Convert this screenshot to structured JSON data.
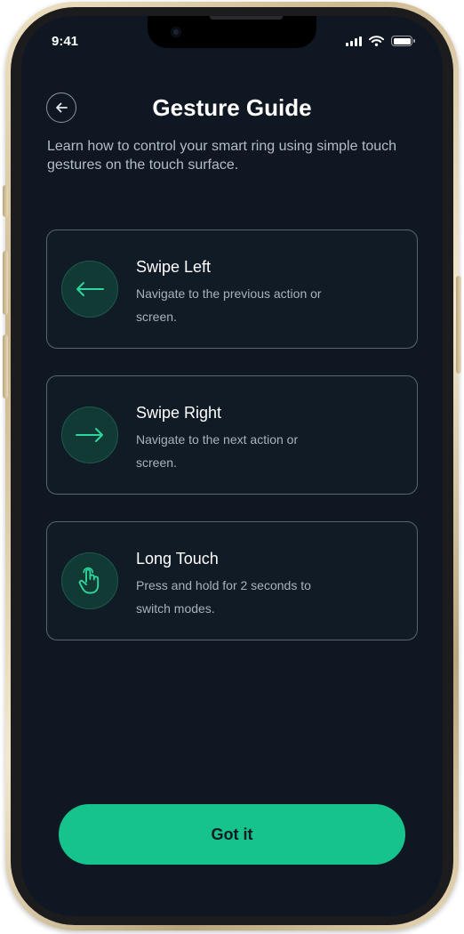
{
  "status_bar": {
    "time": "9:41"
  },
  "header": {
    "title": "Gesture Guide",
    "back_icon": "arrow-left-icon"
  },
  "intro_text": "Learn how to control your smart ring using simple touch gestures on the touch surface.",
  "gestures": [
    {
      "title": "Swipe Left",
      "description": "Navigate to the previous action or screen.",
      "icon": "arrow-left-icon"
    },
    {
      "title": "Swipe Right",
      "description": "Navigate to the next action or screen.",
      "icon": "arrow-right-icon"
    },
    {
      "title": "Long Touch",
      "description": "Press and hold for 2 seconds to switch modes.",
      "icon": "hand-pointer-icon"
    }
  ],
  "primary_button": {
    "label": "Got it"
  },
  "colors": {
    "background": "#0f1822",
    "accent": "#17c38c",
    "icon_circle": "#103a33",
    "card_border": "#5a6470"
  }
}
